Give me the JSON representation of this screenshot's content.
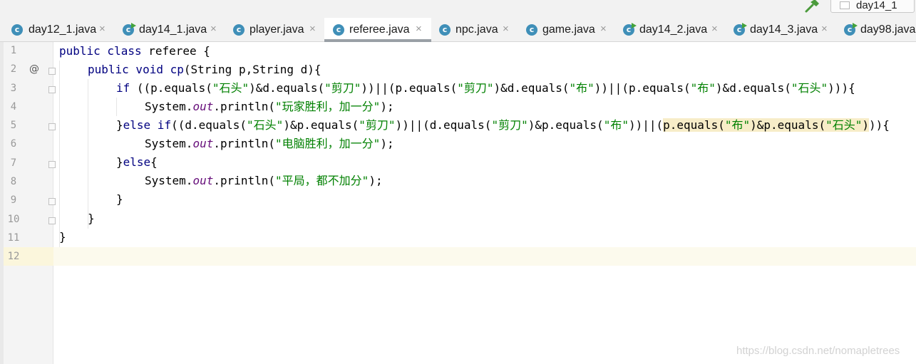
{
  "run_config": {
    "label": "day14_1"
  },
  "tabs": [
    {
      "label": "day12_1.java",
      "icon": "class-c-icon",
      "runnable": false,
      "active": false,
      "close": "×"
    },
    {
      "label": "day14_1.java",
      "icon": "class-c-icon",
      "runnable": true,
      "active": false,
      "close": "×"
    },
    {
      "label": "player.java",
      "icon": "class-c-icon",
      "runnable": false,
      "active": false,
      "close": "×"
    },
    {
      "label": "referee.java",
      "icon": "class-c-icon",
      "runnable": false,
      "active": true,
      "close": "×"
    },
    {
      "label": "npc.java",
      "icon": "class-c-icon",
      "runnable": false,
      "active": false,
      "close": "×"
    },
    {
      "label": "game.java",
      "icon": "class-c-icon",
      "runnable": false,
      "active": false,
      "close": "×"
    },
    {
      "label": "day14_2.java",
      "icon": "class-c-icon",
      "runnable": true,
      "active": false,
      "close": "×"
    },
    {
      "label": "day14_3.java",
      "icon": "class-c-icon",
      "runnable": true,
      "active": false,
      "close": "×"
    },
    {
      "label": "day98.java",
      "icon": "class-c-icon",
      "runnable": true,
      "active": false,
      "close": ""
    }
  ],
  "tab_icon_glyph": "c",
  "gutter": {
    "line_numbers": [
      "1",
      "2",
      "3",
      "4",
      "5",
      "6",
      "7",
      "8",
      "9",
      "10",
      "11",
      "12"
    ],
    "override_marker": "@"
  },
  "code": {
    "line1": {
      "a": "public class",
      "b": " referee {"
    },
    "line2": {
      "a": "public void",
      "b": " ",
      "c": "cp",
      "d": "(String p,String d){"
    },
    "line3": {
      "a": "if",
      "b": " ((p.equals(",
      "c": "\"石头\"",
      "d": ")&d.equals(",
      "e": "\"剪刀\"",
      "f": "))||(p.equals(",
      "g": "\"剪刀\"",
      "h": ")&d.equals(",
      "i": "\"布\"",
      "j": "))||(p.equals(",
      "k": "\"布\"",
      "l": ")&d.equals(",
      "m": "\"石头\"",
      "n": "))){"
    },
    "line4": {
      "a": "System.",
      "b": "out",
      "c": ".println(",
      "d": "\"玩家胜利，加一分\"",
      "e": ");"
    },
    "line5": {
      "a": "}",
      "b": "else if",
      "c": "((d.equals(",
      "d": "\"石头\"",
      "e": ")&p.equals(",
      "f": "\"剪刀\"",
      "g": "))||(d.equals(",
      "h": "\"剪刀\"",
      "i": ")&p.equals(",
      "j": "\"布\"",
      "k": "))||(",
      "l": "p.equals(",
      "m": "\"布\"",
      "n": ")&p.equals(",
      "o": "\"石头\"",
      "p": ")",
      "q": ")){"
    },
    "line6": {
      "a": "System.",
      "b": "out",
      "c": ".println(",
      "d": "\"电脑胜利，加一分\"",
      "e": ");"
    },
    "line7": {
      "a": "}",
      "b": "else",
      "c": "{"
    },
    "line8": {
      "a": "System.",
      "b": "out",
      "c": ".println(",
      "d": "\"平局，都不加分\"",
      "e": ");"
    },
    "line9": {
      "a": "}"
    },
    "line10": {
      "a": "}"
    },
    "line11": {
      "a": "}"
    }
  },
  "watermark": "https://blog.csdn.net/nomapletrees",
  "colors": {
    "keyword": "#000080",
    "string": "#008000",
    "static_field": "#660e7a",
    "class_icon": "#3f8fb8",
    "run_badge": "#44a33c",
    "hammer": "#4b9b3c",
    "highlight": "#f7edc8"
  }
}
